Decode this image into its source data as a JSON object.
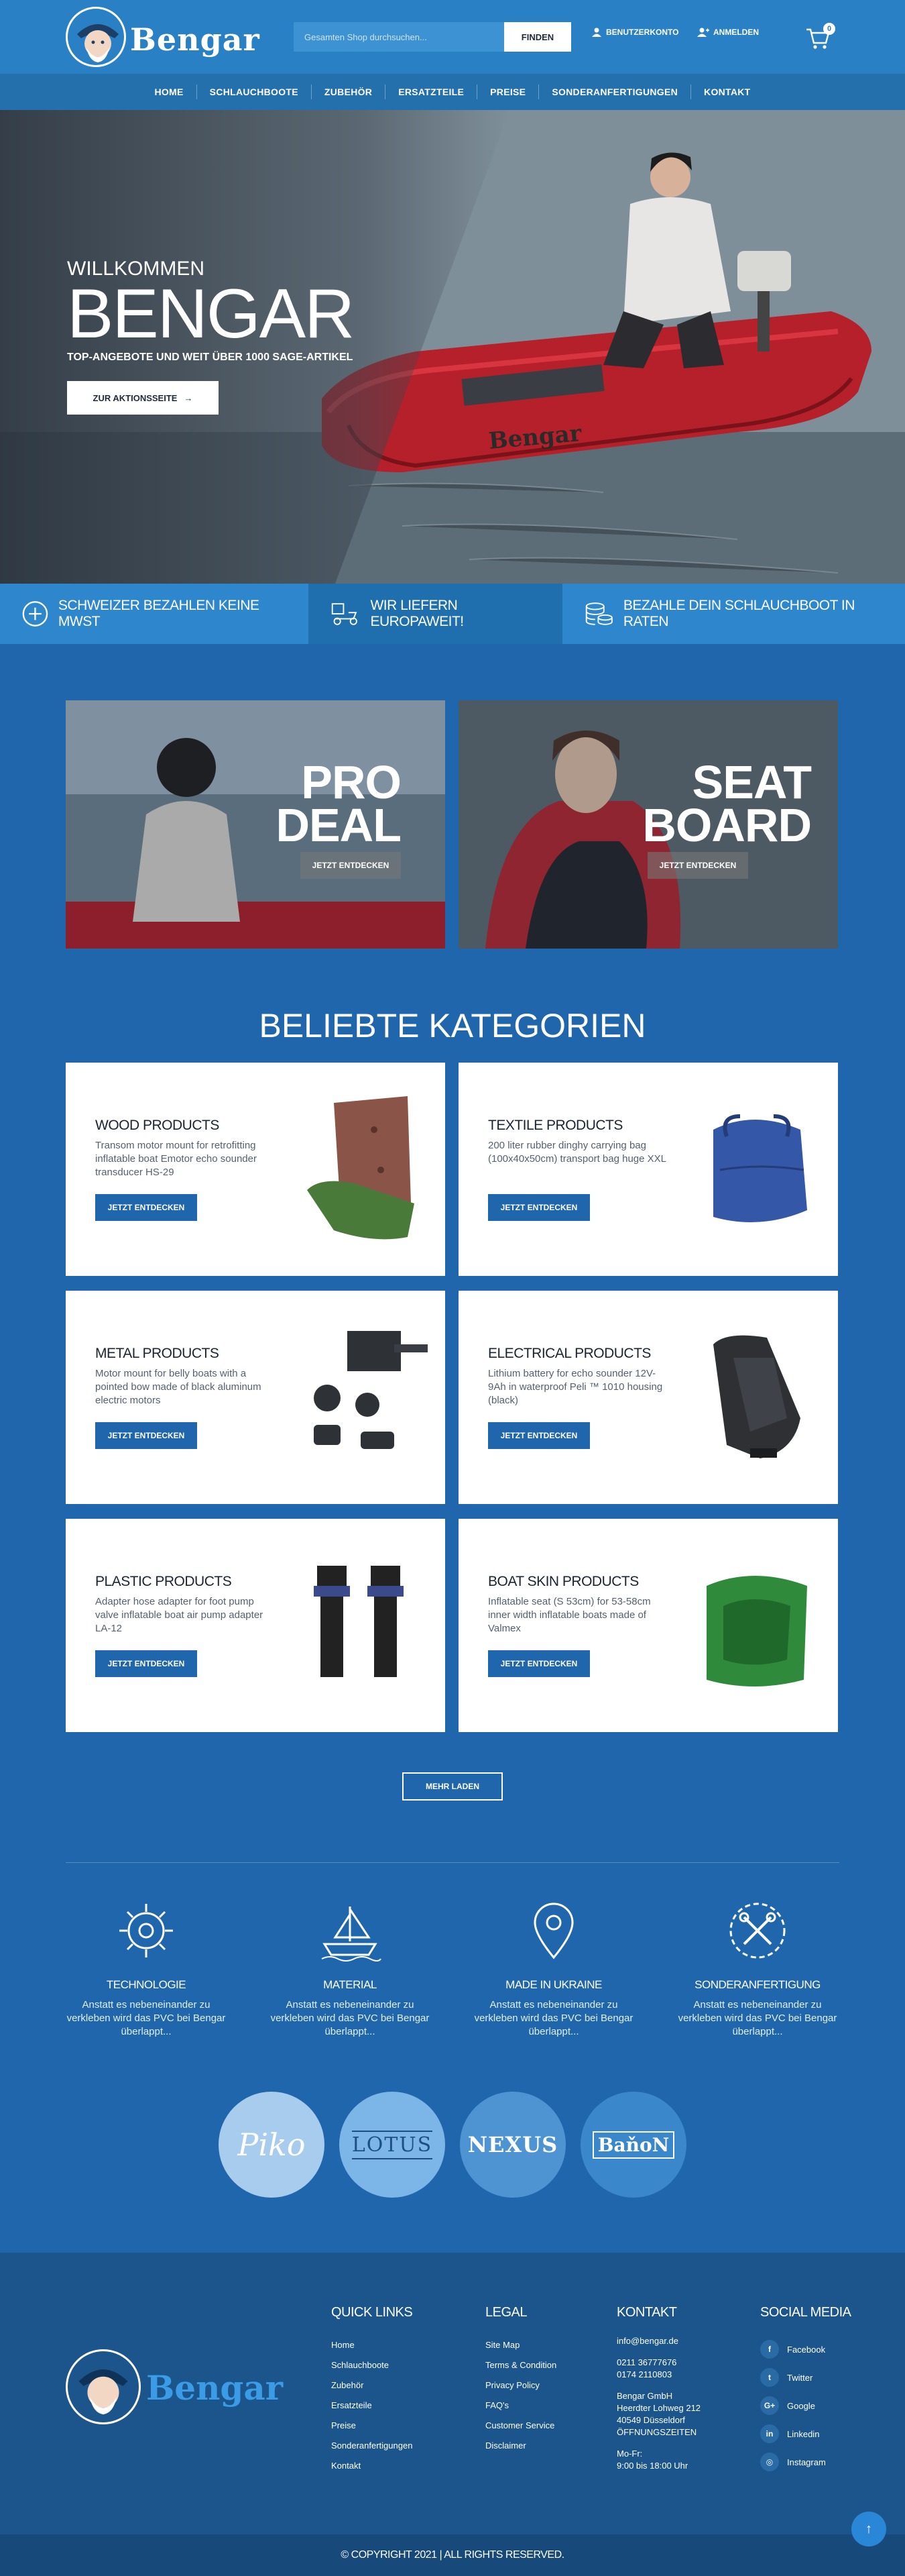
{
  "header": {
    "logo_text": "Bengar",
    "search_placeholder": "Gesamten Shop durchsuchen...",
    "search_button": "FINDEN",
    "account_label": "BENUTZERKONTO",
    "login_label": "ANMELDEN",
    "cart_count": "0"
  },
  "nav": [
    "HOME",
    "SCHLAUCHBOOTE",
    "ZUBEHÖR",
    "ERSATZTEILE",
    "PREISE",
    "SONDERANFERTIGUNGEN",
    "KONTAKT"
  ],
  "hero": {
    "welcome": "WILLKOMMEN",
    "title": "BENGAR",
    "subtitle": "TOP-ANGEBOTE UND WEIT ÜBER 1000 SAGE-ARTIKEL",
    "button": "ZUR AKTIONSSEITE",
    "boat_text": "Bengar"
  },
  "features": [
    {
      "label": "SCHWEIZER BEZAHLEN KEINE MWST",
      "icon": "plus-circle-icon"
    },
    {
      "label": "WIR LIEFERN EUROPAWEIT!",
      "icon": "delivery-scooter-icon"
    },
    {
      "label": "BEZAHLE DEIN SCHLAUCHBOOT IN RATEN",
      "icon": "coins-icon"
    }
  ],
  "promos": [
    {
      "line1": "PRO",
      "line2": "DEAL",
      "button": "JETZT ENTDECKEN"
    },
    {
      "line1": "SEAT",
      "line2": "BOARD",
      "button": "JETZT ENTDECKEN"
    }
  ],
  "categories_title": "BELIEBTE KATEGORIEN",
  "categories": [
    {
      "title": "WOOD PRODUCTS",
      "desc": "Transom motor mount for retrofitting inflatable boat Emotor echo sounder transducer HS-29",
      "button": "JETZT ENTDECKEN"
    },
    {
      "title": "TEXTILE PRODUCTS",
      "desc": "200 liter rubber dinghy carrying bag (100x40x50cm) transport bag huge XXL",
      "button": "JETZT ENTDECKEN"
    },
    {
      "title": "METAL PRODUCTS",
      "desc": "Motor mount for belly boats with a pointed bow made of black aluminum electric motors",
      "button": "JETZT ENTDECKEN"
    },
    {
      "title": "ELECTRICAL PRODUCTS",
      "desc": "Lithium battery for echo sounder 12V-9Ah in waterproof Peli ™ 1010 housing (black)",
      "button": "JETZT ENTDECKEN"
    },
    {
      "title": "PLASTIC PRODUCTS",
      "desc": "Adapter hose adapter for foot pump valve inflatable boat air pump adapter LA-12",
      "button": "JETZT ENTDECKEN"
    },
    {
      "title": "BOAT SKIN PRODUCTS",
      "desc": "Inflatable seat (S 53cm) for 53-58cm inner width inflatable boats made of Valmex",
      "button": "JETZT ENTDECKEN"
    }
  ],
  "more_button": "MEHR LADEN",
  "services": [
    {
      "title": "TECHNOLOGIE",
      "text": "Anstatt es nebeneinander zu verkleben wird das PVC bei Bengar überlappt...",
      "icon": "gear-circuit-icon"
    },
    {
      "title": "MATERIAL",
      "text": "Anstatt es nebeneinander zu verkleben wird das PVC bei Bengar überlappt...",
      "icon": "ship-icon"
    },
    {
      "title": "MADE IN UKRAINE",
      "text": "Anstatt es nebeneinander zu verkleben wird das PVC bei Bengar überlappt...",
      "icon": "map-pin-icon"
    },
    {
      "title": "SONDERANFERTIGUNG",
      "text": "Anstatt es nebeneinander zu verkleben wird das PVC bei Bengar überlappt...",
      "icon": "tools-icon"
    }
  ],
  "brands": [
    "Piko",
    "LOTUS",
    "NEXUS",
    "BaňoN"
  ],
  "footer": {
    "logo_text": "Bengar",
    "quick_links_title": "QUICK LINKS",
    "quick_links": [
      "Home",
      "Schlauchboote",
      "Zubehör",
      "Ersatzteile",
      "Preise",
      "Sonderanfertigungen",
      "Kontakt"
    ],
    "legal_title": "LEGAL",
    "legal": [
      "Site Map",
      "Terms & Condition",
      "Privacy Policy",
      "FAQ's",
      "Customer Service",
      "Disclaimer"
    ],
    "contact_title": "KONTAKT",
    "contact_email": "info@bengar.de",
    "contact_phone1": "0211 36777676",
    "contact_phone2": "0174 2110803",
    "contact_company": "Bengar GmbH",
    "contact_street": "Heerdter Lohweg 212",
    "contact_city": "40549 Düsseldorf",
    "contact_hours_title": "ÖFFNUNGSZEITEN",
    "contact_days": "Mo-Fr:",
    "contact_hours": "9:00 bis 18:00 Uhr",
    "social_title": "SOCIAL MEDIA",
    "social": [
      {
        "label": "Facebook",
        "glyph": "f"
      },
      {
        "label": "Twitter",
        "glyph": "t"
      },
      {
        "label": "Google",
        "glyph": "G+"
      },
      {
        "label": "Linkedin",
        "glyph": "in"
      },
      {
        "label": "Instagram",
        "glyph": "◎"
      }
    ],
    "copyright": "© COPYRIGHT 2021 | ALL RIGHTS RESERVED."
  }
}
